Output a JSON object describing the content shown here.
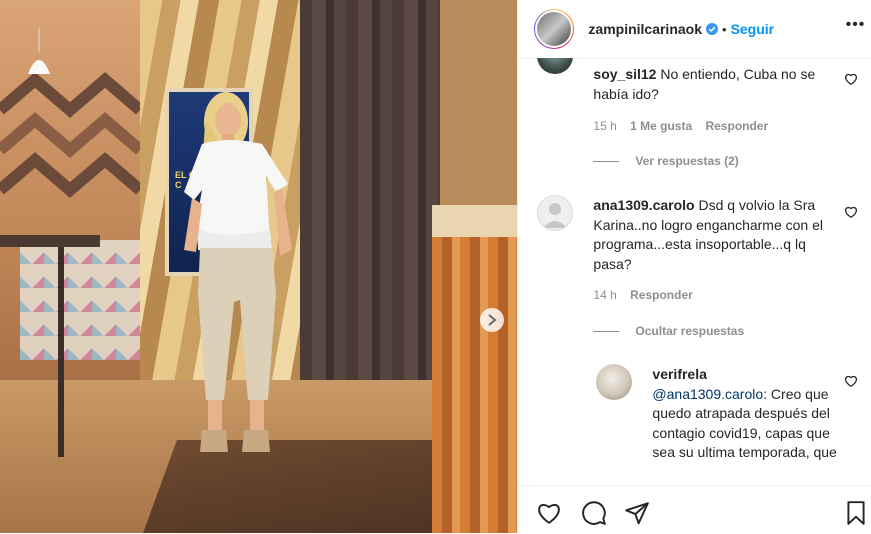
{
  "post": {
    "username": "zampinilcarinaok",
    "dot": "•",
    "follow_label": "Seguir",
    "more_label": "•••"
  },
  "comments": [
    {
      "username": "soy_sil12",
      "text": "No entiendo, Cuba no se había ido?",
      "time": "15 h",
      "likes": "1 Me gusta",
      "reply_label": "Responder",
      "replies_toggle": "Ver respuestas (2)"
    },
    {
      "username": "ana1309.carolo",
      "text": "Dsd q volvio la Sra Karina..no logro engancharme con el programa...esta insoportable...q lq pasa?",
      "time": "14 h",
      "reply_label": "Responder",
      "replies_toggle": "Ocultar respuestas"
    }
  ],
  "reply": {
    "username": "verifrela",
    "mention": "@ana1309.carolo",
    "text": ": Creo que quedo atrapada después del contagio covid19, capas que sea su ultima temporada, que"
  },
  "photo": {
    "screen_text": "EL GRAN DE LA C"
  },
  "icons": {
    "like": "heart-icon",
    "comment": "comment-icon",
    "share": "paper-plane-icon",
    "save": "bookmark-icon",
    "verified": "verified-badge-icon",
    "next": "chevron-right-icon"
  },
  "colors": {
    "follow": "#0095f6",
    "mention": "#00376b",
    "meta": "#8e8e8e"
  }
}
